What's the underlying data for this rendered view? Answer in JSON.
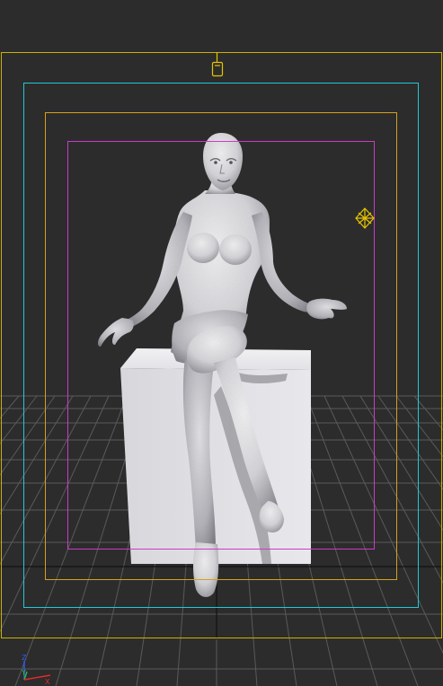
{
  "viewport": {
    "background": "#2c2c2c",
    "grid_color": "#5a5a5a",
    "grid_center_color": "#111111"
  },
  "guides": {
    "render_region_color": "#c8b100",
    "action_safe_color": "#22c9d6",
    "title_safe_color": "#d4a11a",
    "user_safe_color": "#c93cc9"
  },
  "scene": {
    "figure_icon": "seated-woman-figure",
    "pedestal_icon": "box-pedestal",
    "light_icon": "light-gizmo-icon",
    "camera_target_icon": "camera-target-icon"
  },
  "axis_tripod": {
    "z_label": "Z",
    "y_label": "Y",
    "x_label": "X",
    "z_color": "#2a5cff",
    "y_color": "#2fbf3a",
    "x_color": "#e02a2a"
  }
}
